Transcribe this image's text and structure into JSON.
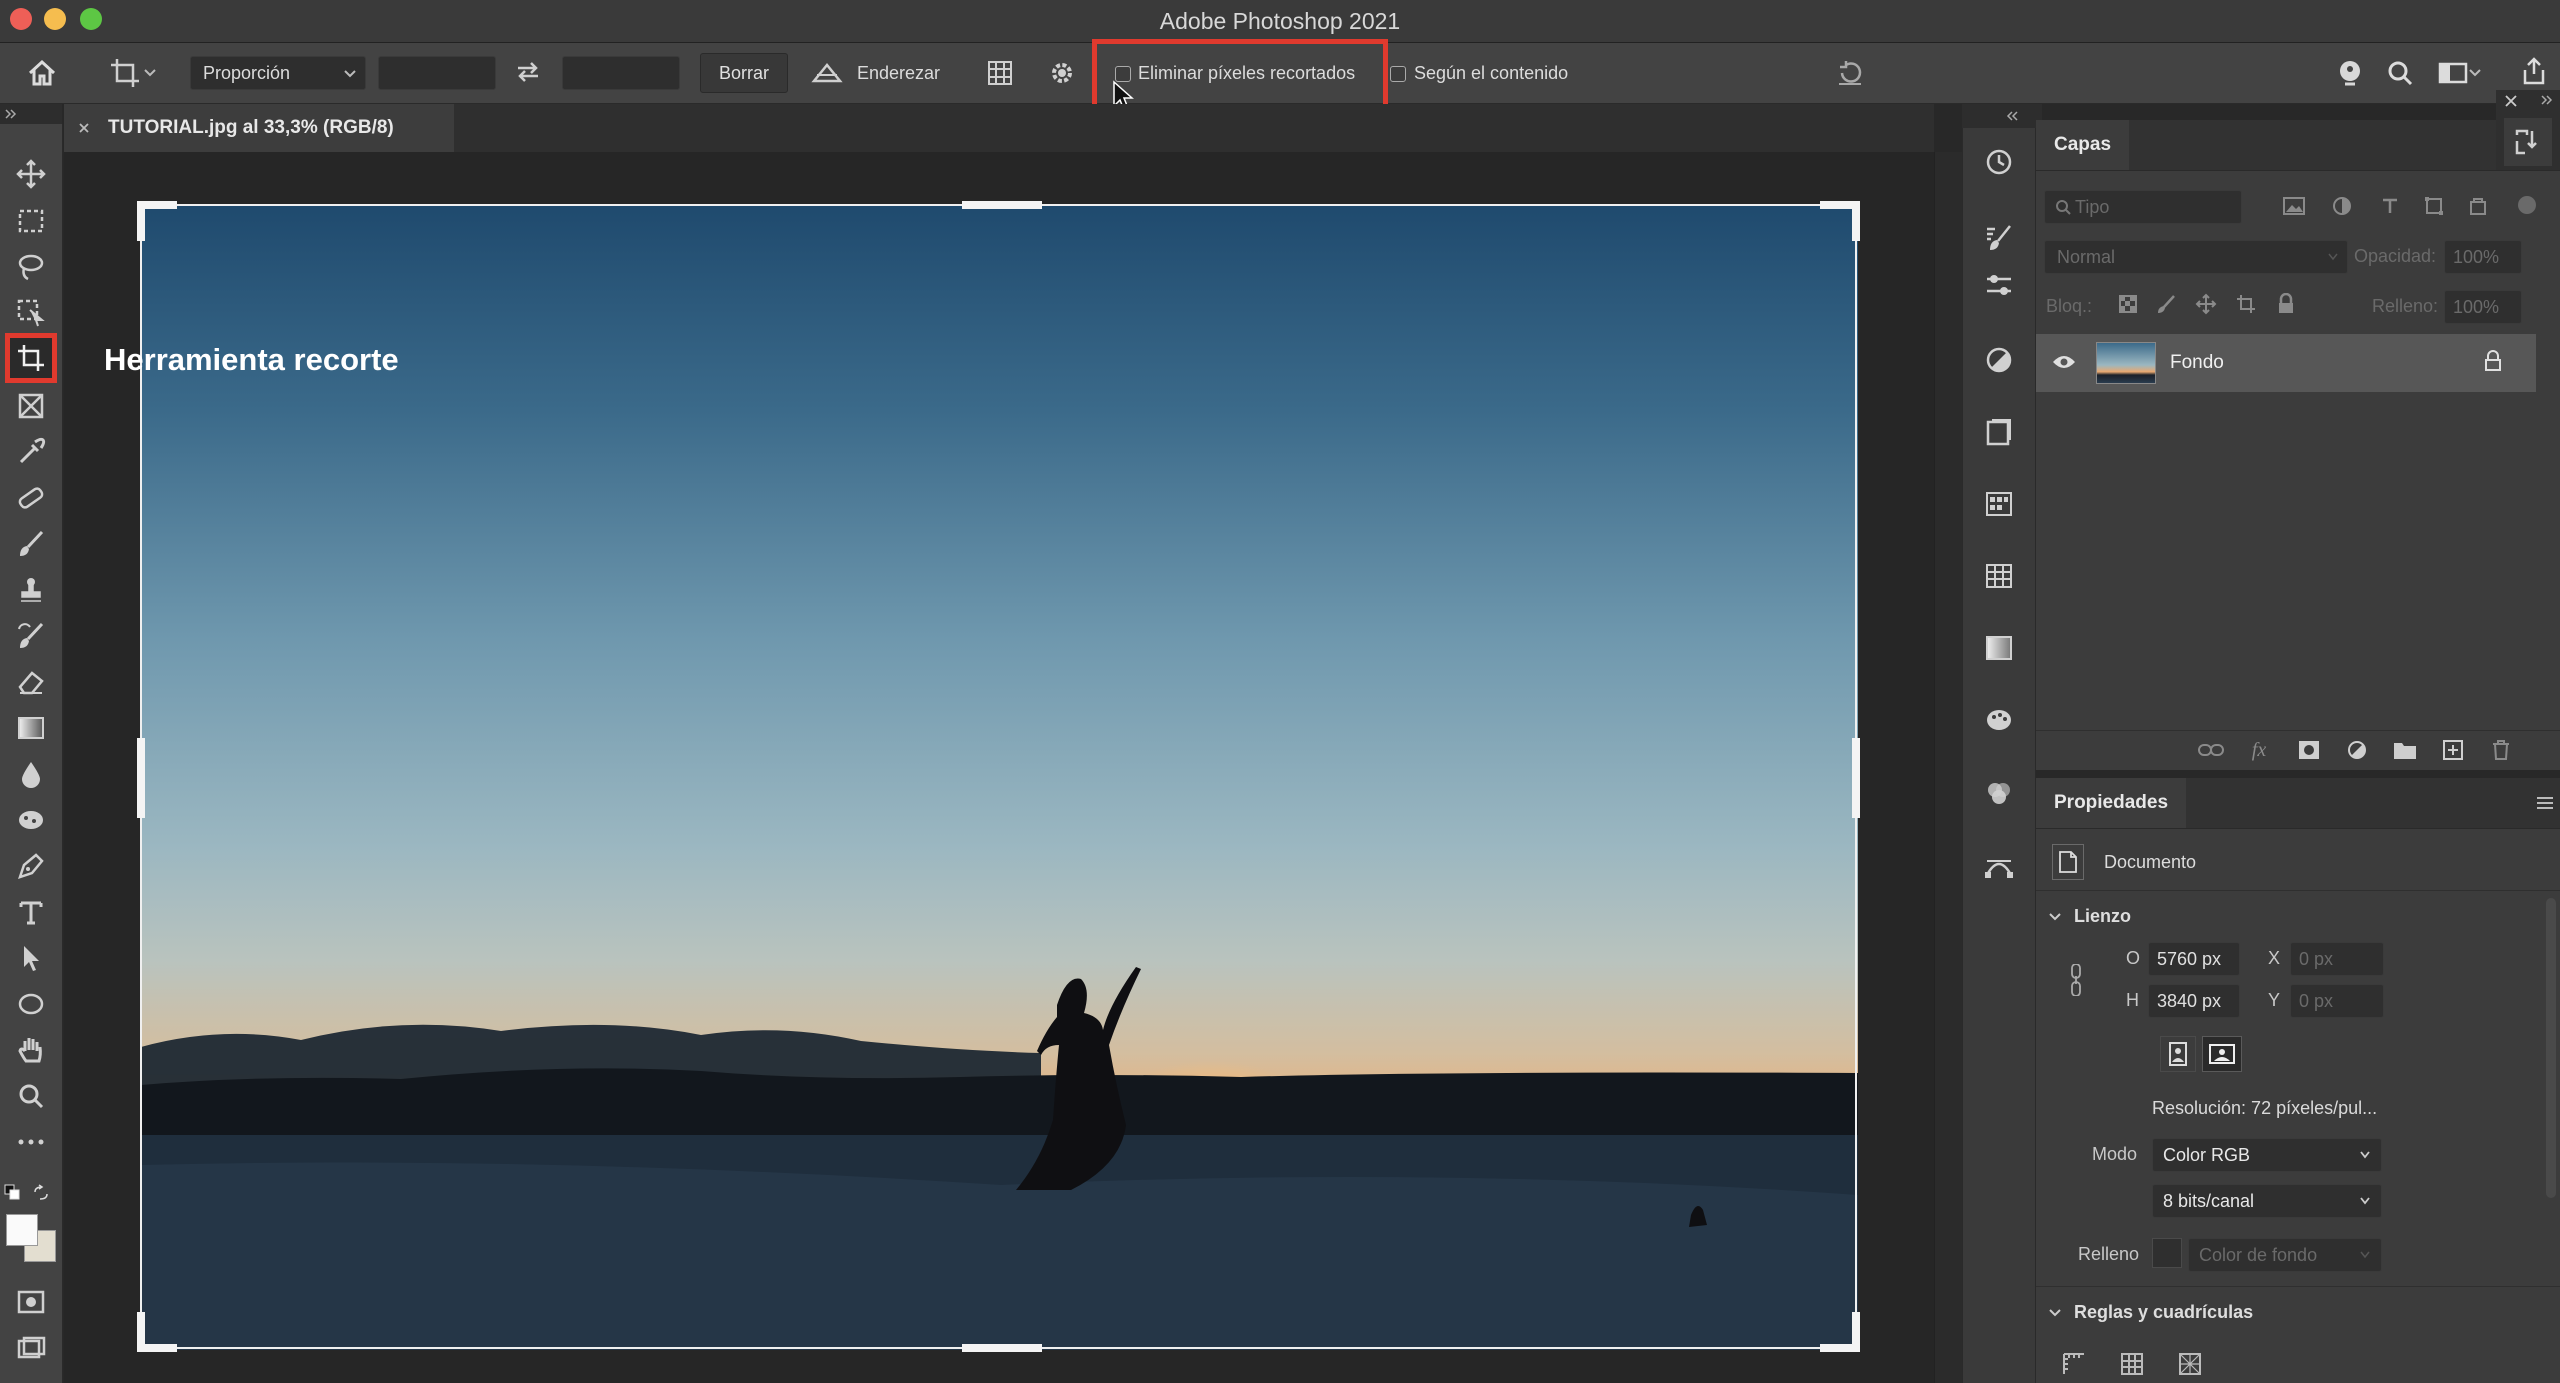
{
  "window": {
    "title": "Adobe Photoshop 2021"
  },
  "options_bar": {
    "ratio_select": "Proporción",
    "clear_button": "Borrar",
    "straighten_label": "Enderezar",
    "delete_cropped_label": "Eliminar píxeles recortados",
    "content_aware_label": "Según el contenido"
  },
  "document_tab": {
    "title": "TUTORIAL.jpg al 33,3% (RGB/8)"
  },
  "canvas": {
    "annotation": "Herramienta recorte"
  },
  "layers_panel": {
    "title": "Capas",
    "filter_kind": "Tipo",
    "blend_mode": "Normal",
    "opacity_label": "Opacidad:",
    "opacity_value": "100%",
    "lock_label": "Bloq.:",
    "fill_label": "Relleno:",
    "fill_value": "100%",
    "layers": [
      {
        "name": "Fondo"
      }
    ]
  },
  "properties_panel": {
    "title": "Propiedades",
    "doc_label": "Documento",
    "canvas_section": "Lienzo",
    "width_label": "O",
    "width_value": "5760 px",
    "height_label": "H",
    "height_value": "3840 px",
    "x_label": "X",
    "x_value": "0 px",
    "y_label": "Y",
    "y_value": "0 px",
    "resolution": "Resolución: 72 píxeles/pul...",
    "mode_label": "Modo",
    "mode_value": "Color RGB",
    "bits_value": "8 bits/canal",
    "fill_label": "Relleno",
    "fill_value": "Color de fondo",
    "rulers_section": "Reglas y cuadrículas"
  },
  "colors": {
    "highlight": "#e03a2e",
    "traffic_close": "#ee5f57",
    "traffic_min": "#f5bd4f",
    "traffic_max": "#5dc744"
  }
}
